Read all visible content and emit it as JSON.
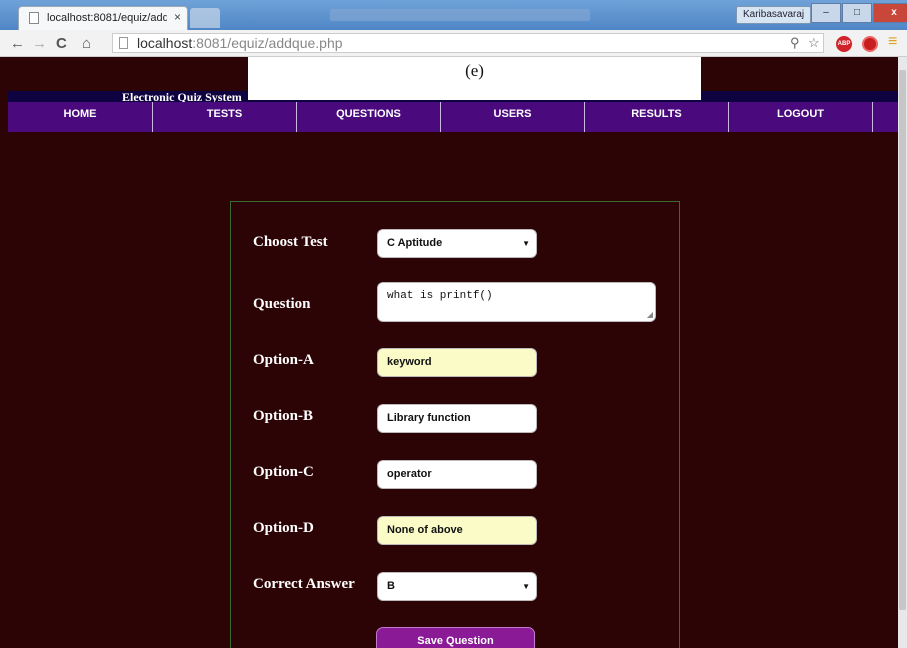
{
  "browser": {
    "tab_title": "localhost:8081/equiz/add",
    "tab_close": "×",
    "url_host": "localhost",
    "url_rest": ":8081/equiz/addque.php",
    "user": "Karibasavaraj",
    "win_min": "–",
    "win_max": "□",
    "win_close": "x",
    "abp": "ABP"
  },
  "caption": "(e)",
  "site": {
    "title": "Electronic Quiz System",
    "nav": [
      "HOME",
      "TESTS",
      "QUESTIONS",
      "USERS",
      "RESULTS",
      "LOGOUT"
    ]
  },
  "form": {
    "test_label": "Choost Test",
    "test_value": "C Aptitude",
    "question_label": "Question",
    "question_value": "what is printf()",
    "option_a_label": "Option-A",
    "option_a_value": "keyword",
    "option_b_label": "Option-B",
    "option_b_value": "Library function",
    "option_c_label": "Option-C",
    "option_c_value": "operator",
    "option_d_label": "Option-D",
    "option_d_value": "None of above",
    "answer_label": "Correct Answer",
    "answer_value": "B",
    "save_label": "Save Question"
  },
  "icons": {
    "back": "back-arrow-icon",
    "forward": "forward-arrow-icon",
    "reload": "reload-icon",
    "home": "home-icon",
    "zoom": "zoom-icon",
    "star": "star-icon",
    "menu": "menu-icon"
  }
}
